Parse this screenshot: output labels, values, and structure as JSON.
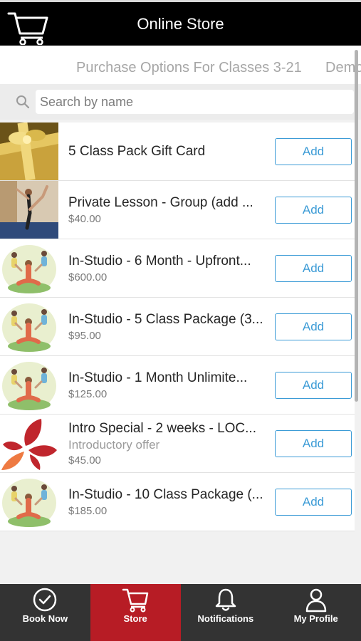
{
  "header": {
    "title": "Online Store",
    "cart_icon": "cart-icon"
  },
  "tabs": [
    {
      "label": "Purchase Options For Classes 3-21"
    },
    {
      "label": "Demo"
    }
  ],
  "search": {
    "placeholder": "Search by name",
    "value": ""
  },
  "products": [
    {
      "name": "5 Class Pack Gift Card",
      "subtitle": "",
      "price": "",
      "thumb": "gift-box-image",
      "button": "Add"
    },
    {
      "name": "Private Lesson - Group (add ...",
      "subtitle": "",
      "price": "$40.00",
      "thumb": "yoga-pose-photo",
      "button": "Add"
    },
    {
      "name": "In-Studio - 6 Month - Upfront...",
      "subtitle": "",
      "price": "$600.00",
      "thumb": "yoga-class-illustration",
      "button": "Add"
    },
    {
      "name": "In-Studio - 5 Class Package (3...",
      "subtitle": "",
      "price": "$95.00",
      "thumb": "yoga-class-illustration",
      "button": "Add"
    },
    {
      "name": "In-Studio - 1 Month Unlimite...",
      "subtitle": "",
      "price": "$125.00",
      "thumb": "yoga-class-illustration",
      "button": "Add"
    },
    {
      "name": "Intro Special - 2 weeks - LOC...",
      "subtitle": "Introductory offer",
      "price": "$45.00",
      "thumb": "lotus-logo",
      "button": "Add"
    },
    {
      "name": "In-Studio - 10 Class Package (...",
      "subtitle": "",
      "price": "$185.00",
      "thumb": "yoga-class-illustration",
      "button": "Add"
    }
  ],
  "nav": [
    {
      "label": "Book Now",
      "icon": "check-circle-icon",
      "active": false
    },
    {
      "label": "Store",
      "icon": "cart-icon",
      "active": true
    },
    {
      "label": "Notifications",
      "icon": "bell-icon",
      "active": false
    },
    {
      "label": "My Profile",
      "icon": "person-icon",
      "active": false
    }
  ],
  "colors": {
    "header_bg": "#000000",
    "accent_blue": "#3b9bd6",
    "active_red": "#b71c25",
    "nav_bg": "#333333"
  }
}
